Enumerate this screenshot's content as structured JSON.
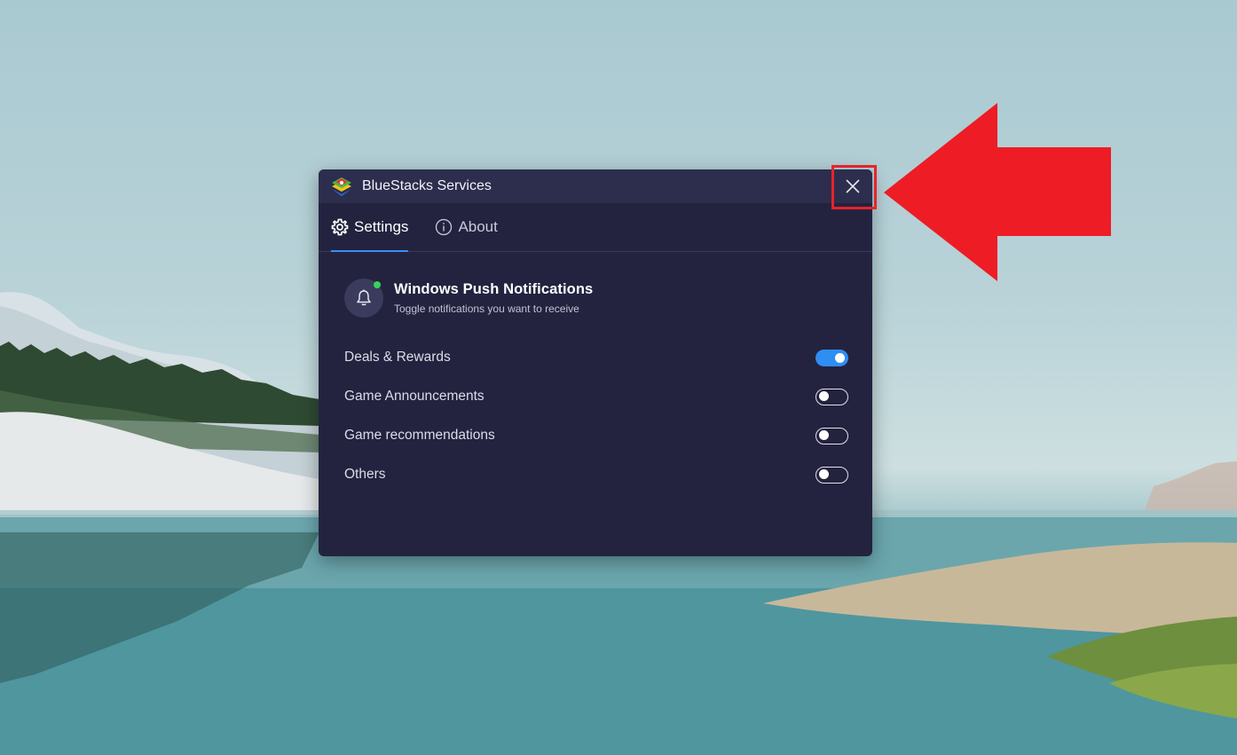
{
  "window": {
    "title": "BlueStacks Services",
    "logo_icon": "bluestacks-logo-icon",
    "close_icon": "close-icon"
  },
  "tabs": [
    {
      "label": "Settings",
      "icon": "gear-icon",
      "active": true
    },
    {
      "label": "About",
      "icon": "info-icon",
      "active": false
    }
  ],
  "notifications": {
    "title": "Windows Push Notifications",
    "subtitle": "Toggle notifications you want to receive",
    "icon": "bell-icon",
    "badge_color": "#36d35b",
    "items": [
      {
        "label": "Deals & Rewards",
        "enabled": true
      },
      {
        "label": "Game Announcements",
        "enabled": false
      },
      {
        "label": "Game recommendations",
        "enabled": false
      },
      {
        "label": "Others",
        "enabled": false
      }
    ]
  },
  "colors": {
    "dialog_bg": "#23233f",
    "titlebar_bg": "#2d2d4d",
    "accent": "#2f8ef2",
    "annotation": "#e8232a"
  }
}
